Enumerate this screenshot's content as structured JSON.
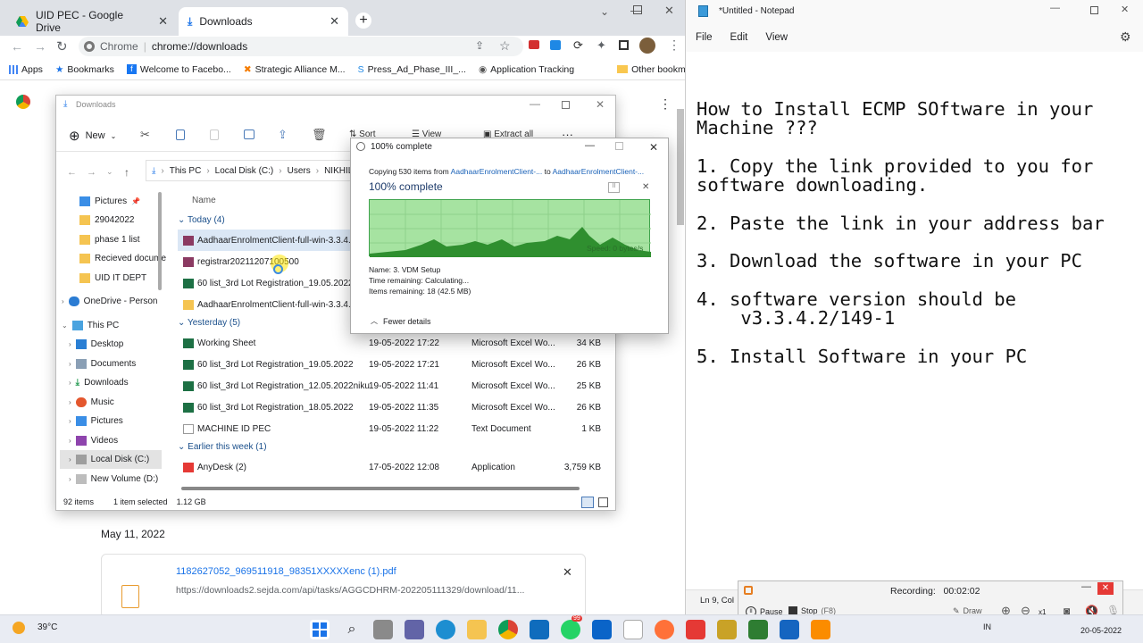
{
  "chrome": {
    "tabs": [
      {
        "label": "UID PEC - Google Drive"
      },
      {
        "label": "Downloads"
      }
    ],
    "omnibox": {
      "chip": "Chrome",
      "url": "chrome://downloads"
    },
    "bookmarks": [
      "Apps",
      "Bookmarks",
      "Welcome to Facebo...",
      "Strategic Alliance M...",
      "Press_Ad_Phase_III_...",
      "Application Tracking",
      "Other bookmarks"
    ],
    "section_date": "May 11, 2022",
    "download_item": {
      "filename": "1182627052_969511918_98351XXXXXenc (1).pdf",
      "url": "https://downloads2.sejda.com/api/tasks/AGGCDHRM-202205111329/download/11..."
    }
  },
  "explorer": {
    "title": "Downloads",
    "toolbar": {
      "new": "New",
      "sort": "Sort",
      "view": "View",
      "extract": "Extract all"
    },
    "breadcrumb": [
      "This PC",
      "Local Disk (C:)",
      "Users",
      "NIKHIL"
    ],
    "nav": [
      "Pictures",
      "29042022",
      "phase 1 list",
      "Recieved docume",
      "UID IT DEPT",
      "OneDrive - Person",
      "This PC",
      "Desktop",
      "Documents",
      "Downloads",
      "Music",
      "Pictures",
      "Videos",
      "Local Disk (C:)",
      "New Volume (D:)"
    ],
    "column_name": "Name",
    "groups": {
      "today": "Today (4)",
      "yesterday": "Yesterday (5)",
      "earlier": "Earlier this week (1)"
    },
    "today_files": [
      "AadhaarEnrolmentClient-full-win-3.3.4.2.1",
      "registrar20211207100500",
      "60 list_3rd Lot Registration_19.05.2022niku",
      "AadhaarEnrolmentClient-full-win-3.3.4.2.1"
    ],
    "yesterday_files": [
      {
        "name": "Working Sheet",
        "date": "19-05-2022 17:22",
        "type": "Microsoft Excel Wo...",
        "size": "34 KB"
      },
      {
        "name": "60 list_3rd Lot Registration_19.05.2022",
        "date": "19-05-2022 17:21",
        "type": "Microsoft Excel Wo...",
        "size": "26 KB"
      },
      {
        "name": "60 list_3rd Lot Registration_12.05.2022niku",
        "date": "19-05-2022 11:41",
        "type": "Microsoft Excel Wo...",
        "size": "25 KB"
      },
      {
        "name": "60 list_3rd Lot Registration_18.05.2022",
        "date": "19-05-2022 11:35",
        "type": "Microsoft Excel Wo...",
        "size": "26 KB"
      },
      {
        "name": "MACHINE ID PEC",
        "date": "19-05-2022 11:22",
        "type": "Text Document",
        "size": "1 KB"
      }
    ],
    "earlier_files": [
      {
        "name": "AnyDesk (2)",
        "date": "17-05-2022 12:08",
        "type": "Application",
        "size": "3,759 KB"
      }
    ],
    "status": {
      "items": "92 items",
      "selected": "1 item selected",
      "size": "1.12 GB"
    }
  },
  "copy_dialog": {
    "title": "100% complete",
    "copying_prefix": "Copying 530 items from",
    "from": "AadhaarEnrolmentClient-...",
    "to_word": "to",
    "to": "AadhaarEnrolmentClient-...",
    "heading": "100% complete",
    "speed": "Speed: 0 bytes/s",
    "name": "Name: 3. VDM Setup",
    "time": "Time remaining: Calculating...",
    "items": "Items remaining: 18 (42.5 MB)",
    "fewer": "Fewer details"
  },
  "notepad": {
    "title": "*Untitled - Notepad",
    "menu": [
      "File",
      "Edit",
      "View"
    ],
    "content": "How to Install ECMP SOftware in your\nMachine ???\n\n1. Copy the link provided to you for\nsoftware downloading.\n\n2. Paste the link in your address bar\n\n3. Download the software in your PC\n\n4. software version should be\n    v3.3.4.2/149-1\n\n5. Install Software in your PC",
    "status": "Ln 9, Col"
  },
  "recorder": {
    "label": "Recording:",
    "time": "00:02:02",
    "pause": "Pause",
    "stop": "Stop",
    "stop_key": "(F8)",
    "draw": "Draw",
    "zoom": "x1"
  },
  "taskbar": {
    "weather": "39°C",
    "lang": "IN",
    "date": "20-05-2022",
    "whatsapp_badge": "99"
  }
}
